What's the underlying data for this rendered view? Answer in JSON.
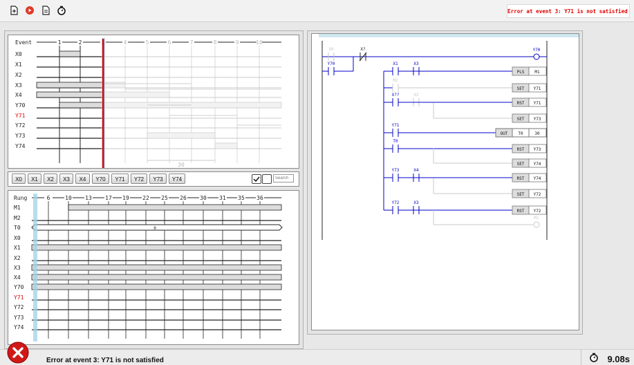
{
  "toolbar": {
    "icons": [
      "new-document-icon",
      "record-icon",
      "document-icon",
      "stopwatch-icon"
    ],
    "error_message": "Error at event 3: Y71 is not satisfied"
  },
  "timing_chart": {
    "header_label": "Event",
    "events": [
      "1",
      "2",
      "3",
      "4",
      "5",
      "6",
      "7",
      "8",
      "9",
      "10"
    ],
    "signals": [
      "X0",
      "X1",
      "X2",
      "X3",
      "X4",
      "Y70",
      "Y71",
      "Y72",
      "Y73",
      "Y74"
    ],
    "failed_signal": "Y71",
    "duration_label": "30"
  },
  "signal_buttons": {
    "labels": [
      "X0",
      "X1",
      "X2",
      "X3",
      "X4",
      "Y70",
      "Y71",
      "Y72",
      "Y73",
      "Y74"
    ],
    "search_placeholder": "Search"
  },
  "rung_chart": {
    "header_label": "Rung",
    "rungs": [
      "6",
      "10",
      "13",
      "17",
      "19",
      "22",
      "25",
      "26",
      "30",
      "31",
      "35",
      "36"
    ],
    "signals": [
      "M1",
      "M2",
      "T0",
      "X0",
      "X1",
      "X2",
      "X3",
      "X4",
      "Y70",
      "Y71",
      "Y72",
      "Y73",
      "Y74"
    ],
    "failed_signal": "Y71",
    "timer_value": "0"
  },
  "ladder": {
    "contacts": {
      "r1_a": "X0",
      "r1_b": "X?",
      "r1_c": "Y70",
      "r2_a": "X1",
      "r2_b": "X3",
      "r3_a": "M2",
      "r4_a": "X??",
      "r4_b": "X2",
      "r6_a": "Y71",
      "r7_a": "T0",
      "r9_a": "Y73",
      "r9_b": "X4",
      "r11_a": "Y72",
      "r11_b": "X3"
    },
    "coils": {
      "out_y70": "Y70",
      "out_m1": "M1"
    },
    "instructions": [
      {
        "op": "PLS",
        "arg": "M1"
      },
      {
        "op": "SET",
        "arg": "Y71"
      },
      {
        "op": "RST",
        "arg": "Y71"
      },
      {
        "op": "SET",
        "arg": "Y73"
      },
      {
        "op": "OUT",
        "arg": "T0",
        "arg2": "30"
      },
      {
        "op": "RST",
        "arg": "Y73"
      },
      {
        "op": "SET",
        "arg": "Y74"
      },
      {
        "op": "RST",
        "arg": "Y74"
      },
      {
        "op": "SET",
        "arg": "Y72"
      },
      {
        "op": "RST",
        "arg": "Y72"
      }
    ]
  },
  "status": {
    "message": "Error at event 3: Y71 is not satisfied",
    "time": "9.08s"
  },
  "colors": {
    "error": "#e00000",
    "ladder_blue": "#0000c8",
    "cursor_red": "#e00000",
    "cursor_blue": "#9fd3e8"
  }
}
